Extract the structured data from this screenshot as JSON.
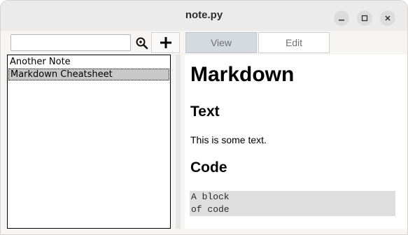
{
  "window": {
    "title": "note.py",
    "controls": [
      "minimize-icon",
      "maximize-icon",
      "close-icon"
    ]
  },
  "toolbar": {
    "search": {
      "value": "",
      "placeholder": ""
    },
    "search_icon": "zoom-icon",
    "add_icon": "plus-icon"
  },
  "tabs": [
    {
      "label": "View",
      "selected": true
    },
    {
      "label": "Edit",
      "selected": false
    }
  ],
  "notes": [
    {
      "label": "Another Note",
      "selected": false
    },
    {
      "label": "Markdown Cheatsheet",
      "selected": true
    }
  ],
  "preview": {
    "h1": "Markdown",
    "h2_text": "Text",
    "paragraph": "This is some text.",
    "h2_code": "Code",
    "code": "A block\nof code"
  },
  "colors": {
    "selected_tab": "#d5d9e0",
    "selected_note": "#c8c8c8",
    "code_background": "#dedede"
  }
}
